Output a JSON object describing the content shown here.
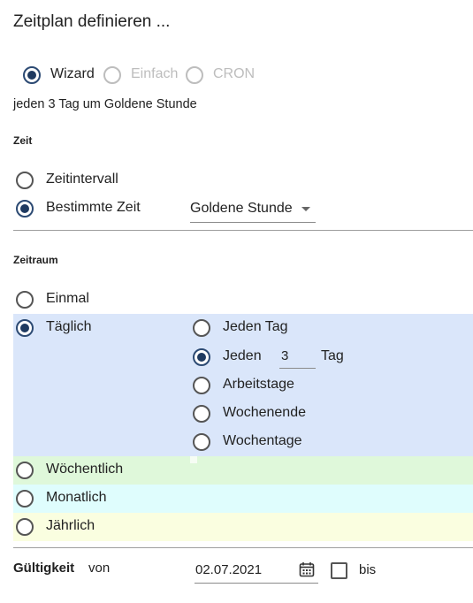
{
  "dialog": {
    "title": "Zeitplan definieren ..."
  },
  "mode": {
    "options": [
      {
        "label": "Wizard",
        "checked": true,
        "disabled": false
      },
      {
        "label": "Einfach",
        "checked": false,
        "disabled": true
      },
      {
        "label": "CRON",
        "checked": false,
        "disabled": true
      }
    ],
    "summary": "jeden 3 Tag um Goldene Stunde"
  },
  "zeit": {
    "heading": "Zeit",
    "options": [
      {
        "label": "Zeitintervall",
        "checked": false
      },
      {
        "label": "Bestimmte Zeit",
        "checked": true
      }
    ],
    "time_select": {
      "value": "Goldene Stunde",
      "icon": "caret-down-icon"
    }
  },
  "zeitraum": {
    "heading": "Zeitraum",
    "options": [
      {
        "label": "Einmal",
        "checked": false
      },
      {
        "label": "Täglich",
        "checked": true,
        "color": "#dae6fa"
      },
      {
        "label": "Wöchentlich",
        "checked": false,
        "color": "#dff8da"
      },
      {
        "label": "Monatlich",
        "checked": false,
        "color": "#dffdfd"
      },
      {
        "label": "Jährlich",
        "checked": false,
        "color": "#fafee0"
      }
    ],
    "daily": {
      "options": [
        {
          "label": "Jeden Tag",
          "checked": false
        },
        {
          "label": "Jeden",
          "checked": true
        },
        {
          "label": "Arbeitstage",
          "checked": false
        },
        {
          "label": "Wochenende",
          "checked": false
        },
        {
          "label": "Wochentage",
          "checked": false
        }
      ],
      "interval_value": "3",
      "interval_unit": "Tag"
    }
  },
  "gueltigkeit": {
    "label": "Gültigkeit",
    "von_label": "von",
    "date_value": "02.07.2021",
    "calendar_icon": "calendar-icon",
    "bis_label": "bis",
    "bis_checked": false
  },
  "colors": {
    "accent": "#1f3a60",
    "radio_border": "#555555",
    "disabled": "#bdbdbd"
  }
}
